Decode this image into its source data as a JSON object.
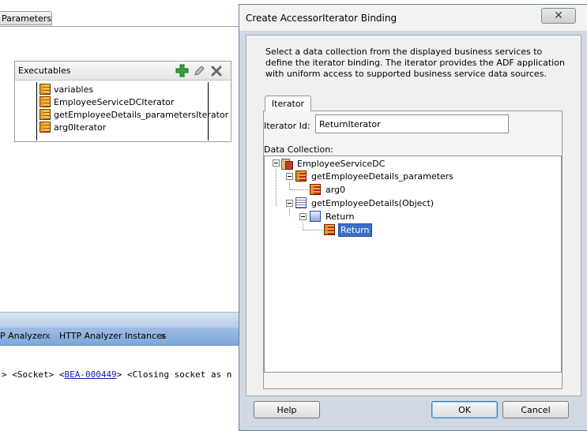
{
  "ide": {
    "parameters_tab": "Parameters",
    "executables": {
      "title": "Executables",
      "items": [
        {
          "label": "variables"
        },
        {
          "label": "EmployeeServiceDCIterator"
        },
        {
          "label": "getEmployeeDetails_parametersIterator"
        },
        {
          "label": "arg0Iterator"
        }
      ]
    },
    "log": {
      "tabs": [
        {
          "label": "P Analyzer"
        },
        {
          "label": "HTTP Analyzer Instances"
        }
      ],
      "close_glyph": "x",
      "line_prefix": "> <Socket> <",
      "line_link": "BEA-000449",
      "line_suffix": "> <Closing socket as n"
    }
  },
  "dialog": {
    "title": "Create AccessorIterator Binding",
    "close_glyph": "✕",
    "description": "Select a data collection from the displayed business services to define the iterator binding. The iterator provides the ADF application with uniform access to supported business service data sources.",
    "tab_label": "Iterator",
    "iterator_id_label": "Iterator Id:",
    "iterator_id_value": "ReturnIterator",
    "data_collection_label": "Data Collection:",
    "tree": [
      {
        "label": "EmployeeServiceDC",
        "icon": "data-control-icon",
        "expanded": true
      },
      {
        "label": "getEmployeeDetails_parameters",
        "icon": "collection-icon",
        "expanded": true
      },
      {
        "label": "arg0",
        "icon": "collection-icon"
      },
      {
        "label": "getEmployeeDetails(Object)",
        "icon": "method-icon",
        "expanded": true
      },
      {
        "label": "Return",
        "icon": "return-icon",
        "expanded": true
      },
      {
        "label": "Return",
        "icon": "collection-icon",
        "selected": true
      }
    ],
    "buttons": {
      "help": "Help",
      "ok": "OK",
      "cancel": "Cancel"
    }
  },
  "colors": {
    "selection": "#3a6fc9",
    "dialog_frame": "#cfd8e3",
    "log_tab_bar": "#7ea7d8",
    "add_icon": "#2fa52f"
  }
}
